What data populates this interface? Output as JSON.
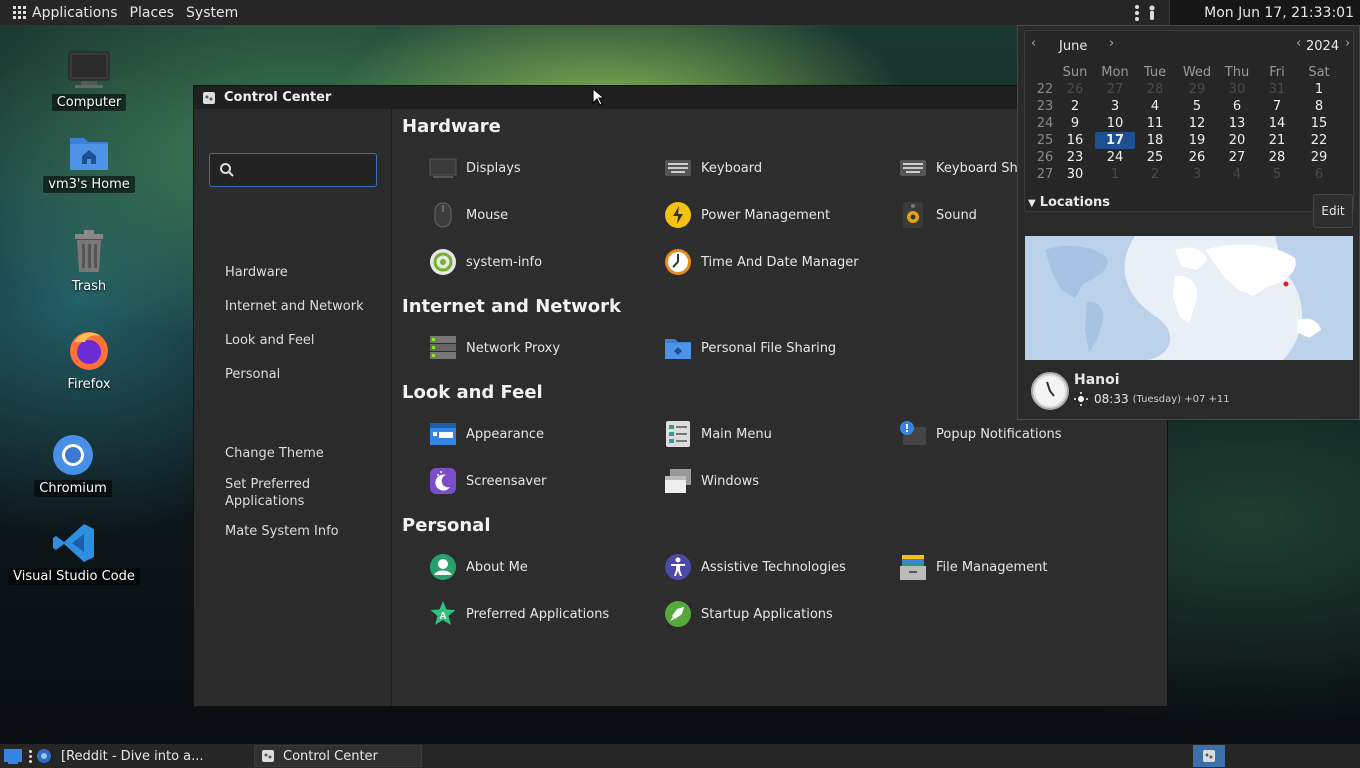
{
  "top_panel": {
    "menus": [
      "Applications",
      "Places",
      "System"
    ],
    "clock": "Mon Jun 17, 21:33:01"
  },
  "desktop": {
    "icons": [
      "Computer",
      "vm3's Home",
      "Trash",
      "Firefox",
      "Chromium",
      "Visual Studio Code"
    ]
  },
  "control_center": {
    "title": "Control Center",
    "search": {
      "value": "",
      "placeholder": ""
    },
    "sidebar_categories": [
      "Hardware",
      "Internet and Network",
      "Look and Feel",
      "Personal"
    ],
    "sidebar_tasks": [
      "Change Theme",
      "Set Preferred Applications",
      "Mate System Info"
    ],
    "sections": [
      {
        "title": "Hardware",
        "items": [
          "Displays",
          "Keyboard",
          "Keyboard Sho",
          "Mouse",
          "Power Management",
          "Sound",
          "system-info",
          "Time And Date Manager"
        ]
      },
      {
        "title": "Internet and Network",
        "items": [
          "Network Proxy",
          "Personal File Sharing"
        ]
      },
      {
        "title": "Look and Feel",
        "items": [
          "Appearance",
          "Main Menu",
          "Popup Notifications",
          "Screensaver",
          "Windows"
        ]
      },
      {
        "title": "Personal",
        "items": [
          "About Me",
          "Assistive Technologies",
          "File Management",
          "Preferred Applications",
          "Startup Applications"
        ]
      }
    ]
  },
  "calendar": {
    "month": "June",
    "year": "2024",
    "weekdays": [
      "Sun",
      "Mon",
      "Tue",
      "Wed",
      "Thu",
      "Fri",
      "Sat"
    ],
    "weeks": [
      {
        "num": "22",
        "days": [
          "26",
          "27",
          "28",
          "29",
          "30",
          "31",
          "1"
        ]
      },
      {
        "num": "23",
        "days": [
          "2",
          "3",
          "4",
          "5",
          "6",
          "7",
          "8"
        ]
      },
      {
        "num": "24",
        "days": [
          "9",
          "10",
          "11",
          "12",
          "13",
          "14",
          "15"
        ]
      },
      {
        "num": "25",
        "days": [
          "16",
          "17",
          "18",
          "19",
          "20",
          "21",
          "22"
        ]
      },
      {
        "num": "26",
        "days": [
          "23",
          "24",
          "25",
          "26",
          "27",
          "28",
          "29"
        ]
      },
      {
        "num": "27",
        "days": [
          "30",
          "1",
          "2",
          "3",
          "4",
          "5",
          "6"
        ]
      }
    ],
    "today": "17",
    "locations_label": "Locations",
    "edit_label": "Edit",
    "location": {
      "city": "Hanoi",
      "time": "08:33",
      "detail": "(Tuesday) +07 +11"
    }
  },
  "taskbar": {
    "tasks": [
      "[Reddit - Dive into a...",
      "Control Center"
    ]
  },
  "colors": {
    "accent": "#1d4f91",
    "panel": "#262626",
    "window": "#2d2d2d"
  }
}
